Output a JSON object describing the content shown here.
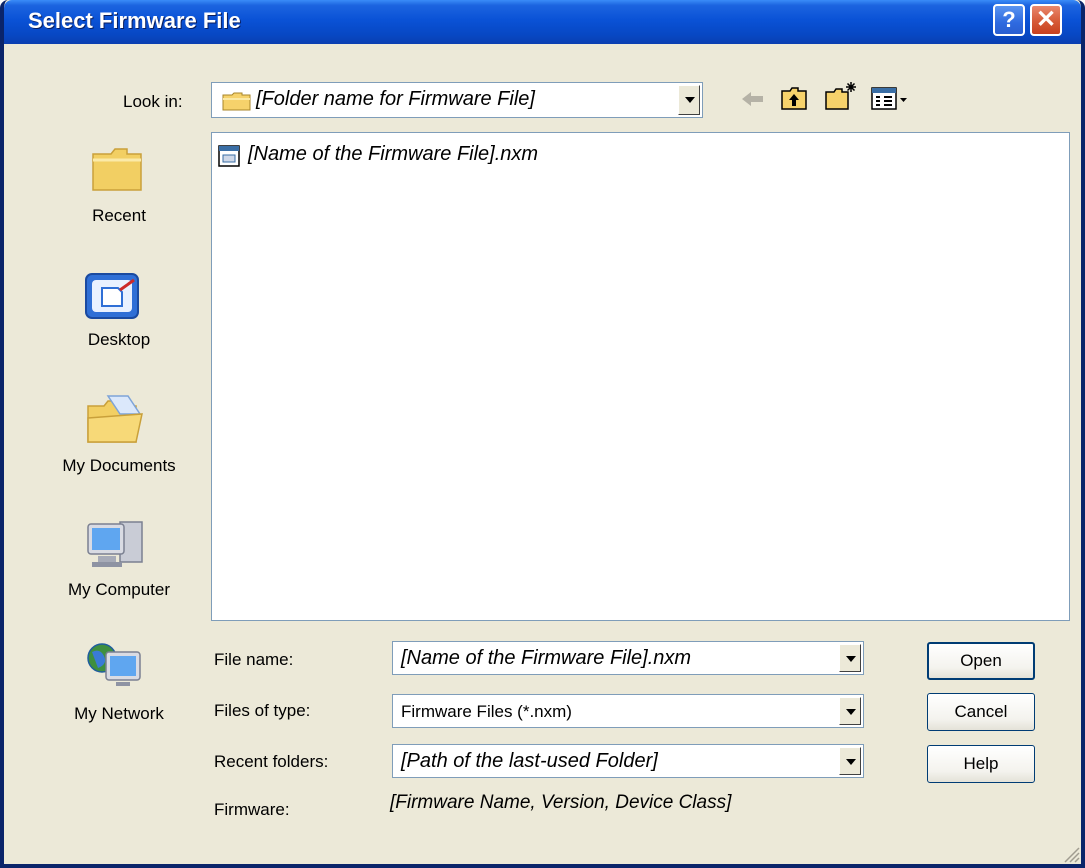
{
  "window": {
    "title": "Select Firmware File"
  },
  "titlebar": {
    "help_glyph": "?",
    "close_glyph": "✕"
  },
  "look_in": {
    "label": "Look in:",
    "value": "[Folder name for Firmware File]"
  },
  "toolbar": {
    "icons": [
      "back-icon",
      "up-folder-icon",
      "new-folder-icon",
      "view-menu-icon"
    ]
  },
  "places": [
    {
      "label": "Recent",
      "icon": "recent-folder-icon"
    },
    {
      "label": "Desktop",
      "icon": "desktop-icon"
    },
    {
      "label": "My Documents",
      "icon": "my-documents-icon"
    },
    {
      "label": "My Computer",
      "icon": "my-computer-icon"
    },
    {
      "label": "My Network",
      "icon": "my-network-icon"
    }
  ],
  "files": [
    {
      "name": "[Name of the Firmware File].nxm",
      "icon": "firmware-file-icon"
    }
  ],
  "file_name": {
    "label": "File name:",
    "value": "[Name of the Firmware File].nxm"
  },
  "file_type": {
    "label": "Files of type:",
    "value": "Firmware Files (*.nxm)"
  },
  "recent_folders": {
    "label": "Recent folders:",
    "value": "[Path of the last-used Folder]"
  },
  "firmware": {
    "label": "Firmware:",
    "value": "[Firmware Name, Version, Device Class]"
  },
  "buttons": {
    "open": "Open",
    "cancel": "Cancel",
    "help": "Help"
  },
  "colors": {
    "title_bar": "#0a52d6",
    "dialog_bg": "#ece9d8",
    "close_button": "#d65a37",
    "field_border": "#7f9db9"
  }
}
